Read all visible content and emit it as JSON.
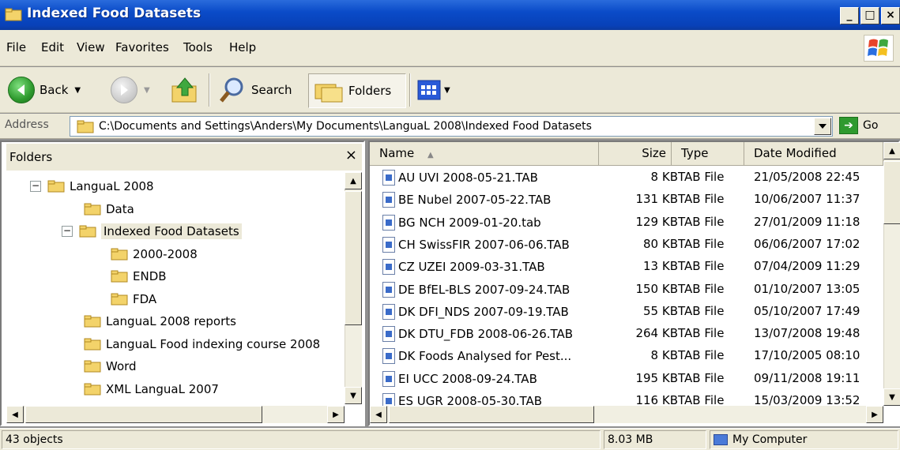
{
  "window": {
    "title": "Indexed Food Datasets"
  },
  "menu": [
    "File",
    "Edit",
    "View",
    "Favorites",
    "Tools",
    "Help"
  ],
  "toolbar": {
    "back_label": "Back",
    "search_label": "Search",
    "folders_label": "Folders"
  },
  "address": {
    "label": "Address",
    "path": "C:\\Documents and Settings\\Anders\\My Documents\\LanguaL 2008\\Indexed Food Datasets",
    "go_label": "Go"
  },
  "folders_panel": {
    "title": "Folders",
    "close_glyph": "×",
    "tree": [
      {
        "label": "LanguaL 2008",
        "expander": "−"
      },
      {
        "label": "Data",
        "expander": ""
      },
      {
        "label": "Indexed Food Datasets",
        "expander": "−"
      },
      {
        "label": "2000-2008",
        "expander": ""
      },
      {
        "label": "ENDB",
        "expander": ""
      },
      {
        "label": "FDA",
        "expander": ""
      },
      {
        "label": "LanguaL 2008 reports",
        "expander": ""
      },
      {
        "label": "LanguaL Food indexing course 2008",
        "expander": ""
      },
      {
        "label": "Word",
        "expander": ""
      },
      {
        "label": "XML LanguaL 2007",
        "expander": ""
      }
    ]
  },
  "file_list": {
    "columns": {
      "name": "Name",
      "size": "Size",
      "type": "Type",
      "date": "Date Modified"
    },
    "rows": [
      {
        "name": "AU UVI 2008-05-21.TAB",
        "size": "8 KB",
        "type": "TAB File",
        "date": "21/05/2008 22:45"
      },
      {
        "name": "BE Nubel 2007-05-22.TAB",
        "size": "131 KB",
        "type": "TAB File",
        "date": "10/06/2007 11:37"
      },
      {
        "name": "BG NCH 2009-01-20.tab",
        "size": "129 KB",
        "type": "TAB File",
        "date": "27/01/2009 11:18"
      },
      {
        "name": "CH SwissFIR 2007-06-06.TAB",
        "size": "80 KB",
        "type": "TAB File",
        "date": "06/06/2007 17:02"
      },
      {
        "name": "CZ UZEI 2009-03-31.TAB",
        "size": "13 KB",
        "type": "TAB File",
        "date": "07/04/2009 11:29"
      },
      {
        "name": "DE BfEL-BLS 2007-09-24.TAB",
        "size": "150 KB",
        "type": "TAB File",
        "date": "01/10/2007 13:05"
      },
      {
        "name": "DK DFI_NDS 2007-09-19.TAB",
        "size": "55 KB",
        "type": "TAB File",
        "date": "05/10/2007 17:49"
      },
      {
        "name": "DK DTU_FDB 2008-06-26.TAB",
        "size": "264 KB",
        "type": "TAB File",
        "date": "13/07/2008 19:48"
      },
      {
        "name": "DK Foods Analysed for Pest...",
        "size": "8 KB",
        "type": "TAB File",
        "date": "17/10/2005 08:10"
      },
      {
        "name": "EI UCC 2008-09-24.TAB",
        "size": "195 KB",
        "type": "TAB File",
        "date": "09/11/2008 19:11"
      },
      {
        "name": "ES UGR 2008-05-30.TAB",
        "size": "116 KB",
        "type": "TAB File",
        "date": "15/03/2009 13:52"
      }
    ]
  },
  "status": {
    "objects": "43 objects",
    "size": "8.03 MB",
    "location": "My Computer"
  },
  "colors": {
    "titlebar": "#0a4bc8",
    "chrome": "#ece9d8",
    "go": "#2f9a2f"
  }
}
